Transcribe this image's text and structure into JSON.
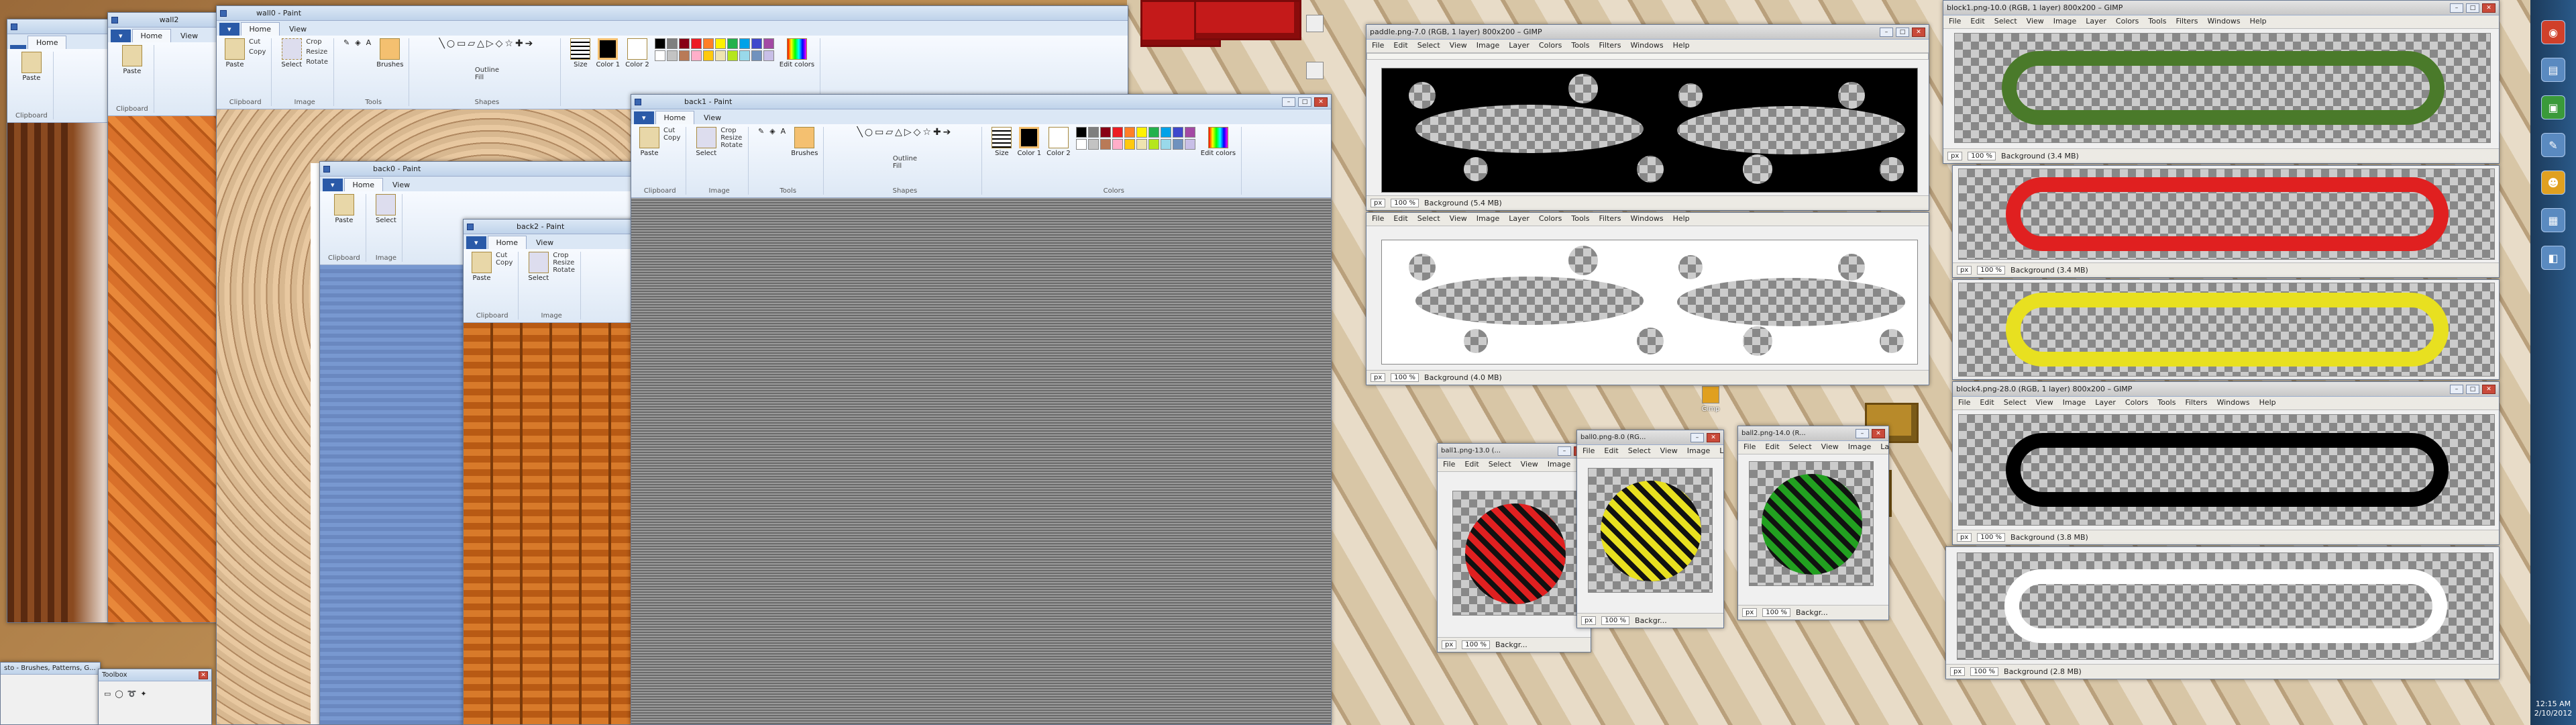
{
  "paint_common": {
    "tab_file": "",
    "tab_home": "Home",
    "tab_view": "View",
    "groups": {
      "clipboard": "Clipboard",
      "image": "Image",
      "tools": "Tools",
      "shapes": "Shapes",
      "colors": "Colors"
    },
    "paste": "Paste",
    "cut": "Cut",
    "copy": "Copy",
    "select": "Select",
    "crop": "Crop",
    "resize": "Resize",
    "rotate": "Rotate",
    "brushes": "Brushes",
    "outline": "Outline",
    "fill": "Fill",
    "size": "Size",
    "color1": "Color 1",
    "color2": "Color 2",
    "edit_colors": "Edit colors"
  },
  "palette": [
    "#000000",
    "#7f7f7f",
    "#880015",
    "#ed1c24",
    "#ff7f27",
    "#fff200",
    "#22b14c",
    "#00a2e8",
    "#3f48cc",
    "#a349a4",
    "#ffffff",
    "#c3c3c3",
    "#b97a57",
    "#ffaec9",
    "#ffc90e",
    "#efe4b0",
    "#b5e61d",
    "#99d9ea",
    "#7092be",
    "#c8bfe7"
  ],
  "paint_windows": {
    "wall0": "wall0 - Paint",
    "wall2": "wall2",
    "back0": "back0 - Paint",
    "back1": "back1 - Paint",
    "back2": "back2 - Paint"
  },
  "gimp_menu": [
    "File",
    "Edit",
    "Select",
    "View",
    "Image",
    "Layer",
    "Colors",
    "Tools",
    "Filters",
    "Windows",
    "Help"
  ],
  "gimp_windows": {
    "paddle": {
      "title": "paddle.png-7.0 (RGB, 1 layer) 800x200 – GIMP",
      "unit": "px",
      "zoom": "100 %",
      "layer": "Background (5.4 MB)"
    },
    "paddle2": {
      "unit": "px",
      "zoom": "100 %",
      "layer": "Background (4.0 MB)"
    },
    "block1": {
      "title": "block1.png-10.0 (RGB, 1 layer) 800x200 – GIMP",
      "unit": "px",
      "zoom": "100 %",
      "layer": "Background (3.4 MB)",
      "color": "#4a7a2a"
    },
    "block2": {
      "unit": "px",
      "zoom": "100 %",
      "layer": "Background (3.4 MB)",
      "color": "#e02020"
    },
    "block3": {
      "color": "#e8e020"
    },
    "block4": {
      "title": "block4.png-28.0 (RGB, 1 layer) 800x200 – GIMP",
      "unit": "px",
      "zoom": "100 %",
      "layer": "Background (3.8 MB)",
      "color": "#000000"
    },
    "block5": {
      "unit": "px",
      "zoom": "100 %",
      "layer": "Background (2.8 MB)",
      "color": "#ffffff"
    },
    "ball1": {
      "title": "ball1.png-13.0 (...",
      "unit": "px",
      "zoom": "100 %",
      "layer": "Backgr...",
      "color": "#e02020"
    },
    "ball0": {
      "title": "ball0.png-8.0 (RG...",
      "unit": "px",
      "zoom": "100 %",
      "layer": "Backgr...",
      "color": "#e8e020"
    },
    "ball2": {
      "title": "ball2.png-14.0 (R...",
      "unit": "px",
      "zoom": "100 %",
      "layer": "Backgr...",
      "color": "#22a020"
    }
  },
  "gimp_short_menu": [
    "File",
    "Edit",
    "Select",
    "View",
    "Image",
    "Layer"
  ],
  "panels": {
    "brushes": "sto - Brushes, Patterns, G...",
    "toolbox": "Toolbox"
  },
  "taskbar": {
    "time": "12:15 AM",
    "date": "2/10/2012"
  },
  "desktop_icons": [
    "Gimp"
  ]
}
